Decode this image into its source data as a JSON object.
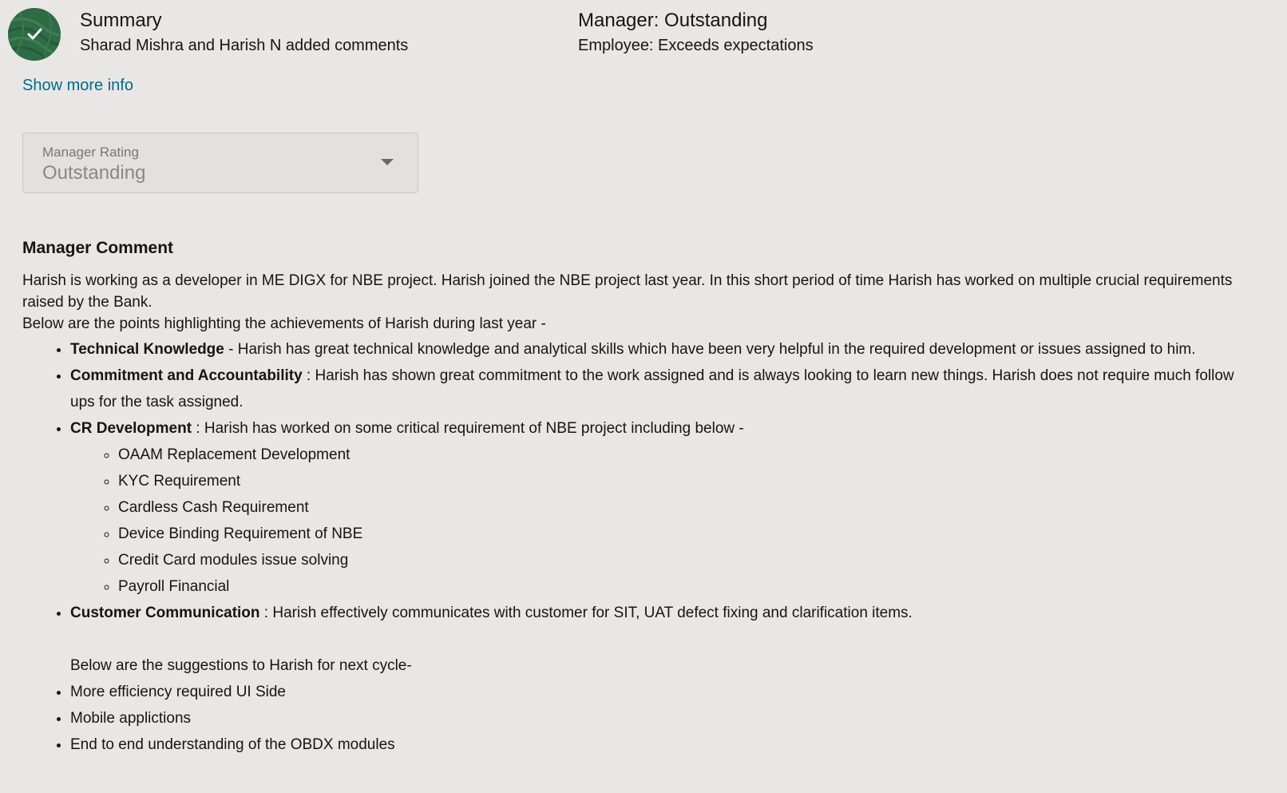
{
  "summary": {
    "title": "Summary",
    "subtitle": "Sharad Mishra and Harish N added comments",
    "status_icon": "check-icon",
    "status_color": "#2f6b45"
  },
  "ratings": {
    "manager": "Manager: Outstanding",
    "employee": "Employee: Exceeds expectations"
  },
  "show_more": "Show more info",
  "manager_rating_select": {
    "label": "Manager Rating",
    "value": "Outstanding"
  },
  "manager_comment": {
    "heading": "Manager Comment",
    "intro_1": "Harish is working as a developer in ME DIGX for NBE project. Harish joined the NBE project last year. In this short period of time Harish has worked on multiple crucial requirements raised by the Bank.",
    "intro_2": "Below are the points highlighting the achievements of Harish during last year -",
    "points": [
      {
        "title": "Technical Knowledge",
        "text": " - Harish has great technical knowledge and analytical skills which have been very helpful in the required development or issues assigned to him."
      },
      {
        "title": "Commitment and Accountability",
        "text": " : Harish has shown great commitment to the work assigned and is always looking to learn new things. Harish does not require much follow ups for the task assigned."
      },
      {
        "title": "CR Development",
        "text": " : Harish has worked on some critical requirement of NBE project including below -"
      },
      {
        "title": "Customer Communication",
        "text": " : Harish effectively communicates with customer for SIT, UAT defect fixing and clarification items."
      }
    ],
    "cr_items": [
      "OAAM Replacement Development",
      "KYC Requirement",
      "Cardless Cash Requirement",
      "Device Binding Requirement of NBE",
      "Credit Card modules issue solving",
      "Payroll Financial"
    ],
    "suggestions_intro": "Below are the suggestions to Harish for next cycle-",
    "suggestions": [
      "More efficiency required UI Side",
      "Mobile applictions",
      "End to end understanding of the OBDX modules"
    ]
  }
}
